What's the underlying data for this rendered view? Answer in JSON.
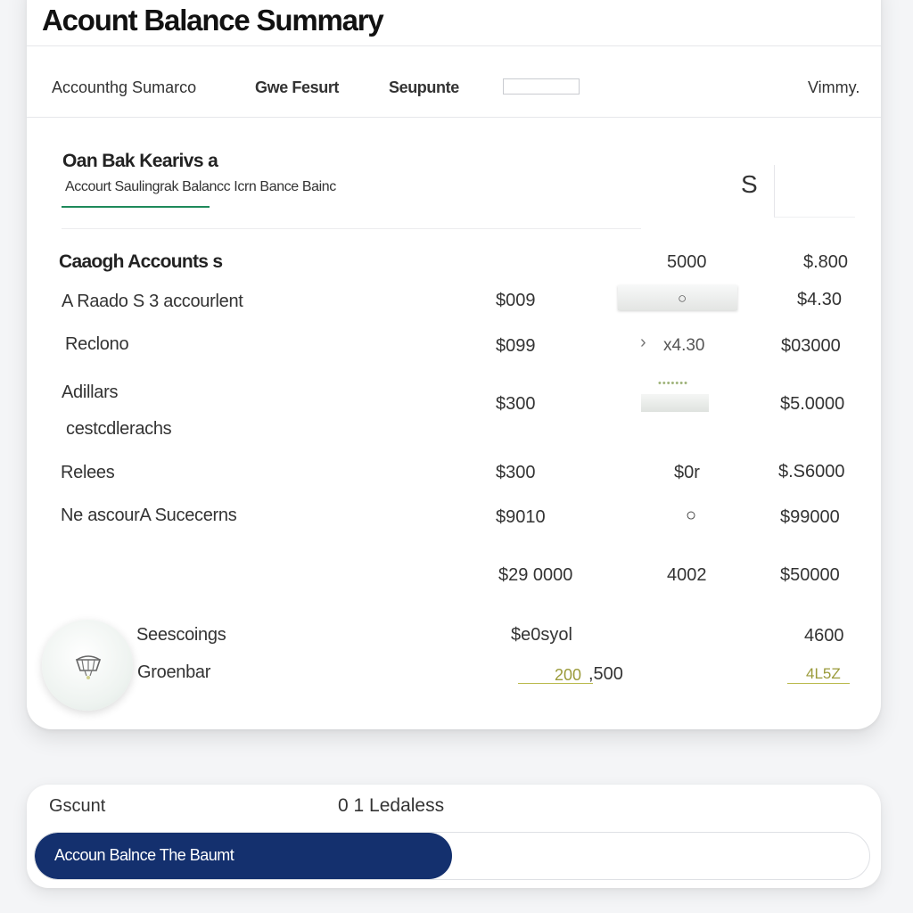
{
  "header": {
    "title": "Acount Balance Summary"
  },
  "tabs": [
    {
      "label": "Accounthg Sumarco"
    },
    {
      "label": "Gwe Fesurt"
    },
    {
      "label": "Seupunte"
    },
    {
      "label": "Vimmy."
    }
  ],
  "section": {
    "title": "Oan Bak Kearivs a",
    "subtitle": "Accourt Saulingrak Balancc Icrn Bance Bainc",
    "side_symbol": "S"
  },
  "table": {
    "group_title": "Caaogh Accounts s",
    "header_values": [
      "5000",
      "$.800"
    ],
    "rows": [
      {
        "label": "A Raado  S 3 accourlent",
        "col1": "$009",
        "col2": "",
        "col3": "$4.30"
      },
      {
        "label": "Reclono",
        "col1": "$099",
        "col2": "x4.30",
        "col3": "$03000"
      },
      {
        "label": "Adillars",
        "label2": "cestcdlerachs",
        "col1": "$300",
        "col2": "",
        "col3": "$5.0000"
      },
      {
        "label": "Relees",
        "col1": "$300",
        "col2": "$0r",
        "col3": "$.S6000"
      },
      {
        "label": "Ne ascourA Sucecerns",
        "col1": "$9010",
        "col2": "",
        "col3": "$99000"
      },
      {
        "label": "",
        "col1": "$29 0000",
        "col2": "4002",
        "col3": "$50000"
      }
    ],
    "footer": [
      {
        "label": "Seescoings",
        "col1": "$e0syol",
        "col3": "4600"
      },
      {
        "label": "Groenbar",
        "col1a": "200",
        "col1b": ",500",
        "col3": "4L5Z"
      }
    ]
  },
  "icons": {
    "field_icon": "○",
    "chevron": "›",
    "indicator": "○",
    "dots": "•••••••"
  },
  "bottom": {
    "label": "Gscunt",
    "value": "0 1 Ledaless",
    "progress_text": "Accoun Balnce The Baumt",
    "progress": 0.5
  },
  "colors": {
    "accent_green": "#1f8a5b",
    "progress_navy": "#14306e",
    "olive": "#9a9a3a"
  }
}
